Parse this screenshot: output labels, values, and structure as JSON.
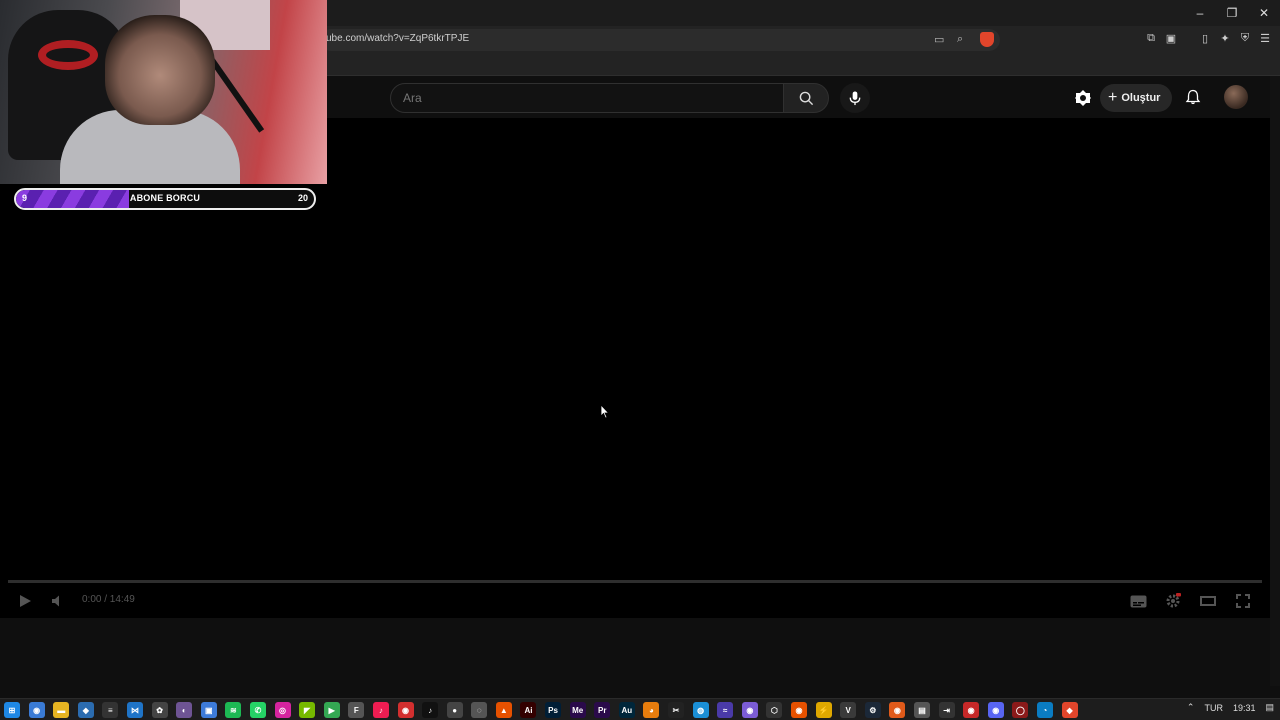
{
  "browser": {
    "url": "ube.com/watch?v=ZqP6tkrTPJE",
    "window_controls": [
      "–",
      "❐",
      "✕"
    ]
  },
  "youtube": {
    "search_placeholder": "Ara",
    "create_label": "Oluştur"
  },
  "player": {
    "time": "0:00 / 14:49",
    "progress": 0
  },
  "overlay": {
    "sub_start": "9",
    "sub_label": "ABONE BORCU",
    "sub_goal": "20",
    "sub_progress": 0.38
  },
  "tray": {
    "language": "TUR",
    "clock": "19:31"
  },
  "taskbar_icons": [
    {
      "name": "windows-start-icon",
      "color": "#1e88e5",
      "glyph": "⊞"
    },
    {
      "name": "app-icon-1",
      "color": "#3a7bd5",
      "glyph": "◉"
    },
    {
      "name": "file-explorer-icon",
      "color": "#e6b422",
      "glyph": "▬"
    },
    {
      "name": "app-icon-3",
      "color": "#2b6cb0",
      "glyph": "◆"
    },
    {
      "name": "app-icon-4",
      "color": "#333",
      "glyph": "≡"
    },
    {
      "name": "vscode-icon",
      "color": "#1f74c7",
      "glyph": "⋈"
    },
    {
      "name": "chatgpt-icon",
      "color": "#444",
      "glyph": "✿"
    },
    {
      "name": "github-icon",
      "color": "#6e5494",
      "glyph": "◐"
    },
    {
      "name": "app-icon-8",
      "color": "#3d7bd9",
      "glyph": "▣"
    },
    {
      "name": "spotify-icon",
      "color": "#1db954",
      "glyph": "≋"
    },
    {
      "name": "whatsapp-icon",
      "color": "#25d366",
      "glyph": "✆"
    },
    {
      "name": "instagram-icon",
      "color": "#d6249f",
      "glyph": "◎"
    },
    {
      "name": "nvidia-icon",
      "color": "#76b900",
      "glyph": "◤"
    },
    {
      "name": "play-store-icon",
      "color": "#34a853",
      "glyph": "▶"
    },
    {
      "name": "app-icon-14",
      "color": "#555",
      "glyph": "F"
    },
    {
      "name": "tiktok-icon-1",
      "color": "#ee1d52",
      "glyph": "♪"
    },
    {
      "name": "app-icon-16",
      "color": "#d32f2f",
      "glyph": "◉"
    },
    {
      "name": "tiktok-icon-2",
      "color": "#111",
      "glyph": "♪"
    },
    {
      "name": "app-icon-18",
      "color": "#444",
      "glyph": "●"
    },
    {
      "name": "app-icon-19",
      "color": "#555",
      "glyph": "◌"
    },
    {
      "name": "app-icon-20",
      "color": "#e65100",
      "glyph": "▲"
    },
    {
      "name": "illustrator-icon",
      "color": "#330000",
      "glyph": "Ai"
    },
    {
      "name": "photoshop-icon",
      "color": "#001e36",
      "glyph": "Ps"
    },
    {
      "name": "media-encoder-icon",
      "color": "#2a0a4a",
      "glyph": "Me"
    },
    {
      "name": "premiere-icon",
      "color": "#2a0a4a",
      "glyph": "Pr"
    },
    {
      "name": "audition-icon",
      "color": "#00263a",
      "glyph": "Au"
    },
    {
      "name": "blender-icon",
      "color": "#e87d0d",
      "glyph": "◕"
    },
    {
      "name": "capcut-icon",
      "color": "#222",
      "glyph": "✂"
    },
    {
      "name": "app-icon-28",
      "color": "#1a8fd6",
      "glyph": "◍"
    },
    {
      "name": "app-icon-29",
      "color": "#4a3aa8",
      "glyph": "≈"
    },
    {
      "name": "app-icon-30",
      "color": "#7b5cd6",
      "glyph": "◉"
    },
    {
      "name": "app-icon-31",
      "color": "#333",
      "glyph": "⬡"
    },
    {
      "name": "app-icon-32",
      "color": "#e65100",
      "glyph": "◉"
    },
    {
      "name": "app-icon-33",
      "color": "#e0a800",
      "glyph": "⚡"
    },
    {
      "name": "app-icon-34",
      "color": "#3a3a3a",
      "glyph": "V"
    },
    {
      "name": "steam-icon",
      "color": "#1b2838",
      "glyph": "⚙"
    },
    {
      "name": "app-icon-36",
      "color": "#e05a1a",
      "glyph": "◉"
    },
    {
      "name": "app-icon-37",
      "color": "#555",
      "glyph": "▤"
    },
    {
      "name": "app-icon-38",
      "color": "#333",
      "glyph": "⇥"
    },
    {
      "name": "app-icon-39",
      "color": "#c62828",
      "glyph": "◉"
    },
    {
      "name": "discord-icon",
      "color": "#5865f2",
      "glyph": "◉"
    },
    {
      "name": "app-icon-41",
      "color": "#8b1a1a",
      "glyph": "◯"
    },
    {
      "name": "edge-icon",
      "color": "#0a7cc2",
      "glyph": "◔"
    },
    {
      "name": "brave-icon",
      "color": "#e1452b",
      "glyph": "◆"
    }
  ]
}
